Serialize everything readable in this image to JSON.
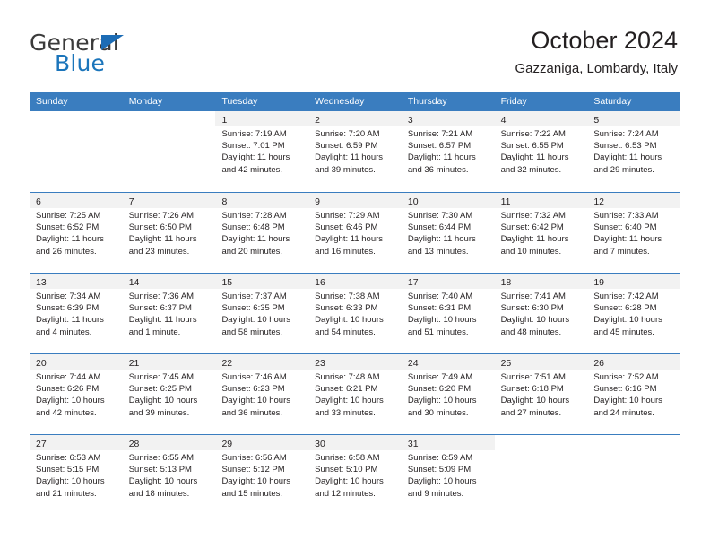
{
  "brand": {
    "name_top": "General",
    "name_bottom": "Blue",
    "triangle_color": "#1c6cb5",
    "blue_text_color": "#1b75bb"
  },
  "header": {
    "title": "October 2024",
    "subtitle": "Gazzaniga, Lombardy, Italy"
  },
  "colors": {
    "header_blue": "#3a7dbf",
    "daynum_band": "#f2f2f2",
    "text": "#231f20"
  },
  "weekdays": [
    "Sunday",
    "Monday",
    "Tuesday",
    "Wednesday",
    "Thursday",
    "Friday",
    "Saturday"
  ],
  "weeks": [
    [
      {
        "empty": true
      },
      {
        "empty": true
      },
      {
        "day": "1",
        "sunrise": "Sunrise: 7:19 AM",
        "sunset": "Sunset: 7:01 PM",
        "daylight1": "Daylight: 11 hours",
        "daylight2": "and 42 minutes."
      },
      {
        "day": "2",
        "sunrise": "Sunrise: 7:20 AM",
        "sunset": "Sunset: 6:59 PM",
        "daylight1": "Daylight: 11 hours",
        "daylight2": "and 39 minutes."
      },
      {
        "day": "3",
        "sunrise": "Sunrise: 7:21 AM",
        "sunset": "Sunset: 6:57 PM",
        "daylight1": "Daylight: 11 hours",
        "daylight2": "and 36 minutes."
      },
      {
        "day": "4",
        "sunrise": "Sunrise: 7:22 AM",
        "sunset": "Sunset: 6:55 PM",
        "daylight1": "Daylight: 11 hours",
        "daylight2": "and 32 minutes."
      },
      {
        "day": "5",
        "sunrise": "Sunrise: 7:24 AM",
        "sunset": "Sunset: 6:53 PM",
        "daylight1": "Daylight: 11 hours",
        "daylight2": "and 29 minutes."
      }
    ],
    [
      {
        "day": "6",
        "sunrise": "Sunrise: 7:25 AM",
        "sunset": "Sunset: 6:52 PM",
        "daylight1": "Daylight: 11 hours",
        "daylight2": "and 26 minutes."
      },
      {
        "day": "7",
        "sunrise": "Sunrise: 7:26 AM",
        "sunset": "Sunset: 6:50 PM",
        "daylight1": "Daylight: 11 hours",
        "daylight2": "and 23 minutes."
      },
      {
        "day": "8",
        "sunrise": "Sunrise: 7:28 AM",
        "sunset": "Sunset: 6:48 PM",
        "daylight1": "Daylight: 11 hours",
        "daylight2": "and 20 minutes."
      },
      {
        "day": "9",
        "sunrise": "Sunrise: 7:29 AM",
        "sunset": "Sunset: 6:46 PM",
        "daylight1": "Daylight: 11 hours",
        "daylight2": "and 16 minutes."
      },
      {
        "day": "10",
        "sunrise": "Sunrise: 7:30 AM",
        "sunset": "Sunset: 6:44 PM",
        "daylight1": "Daylight: 11 hours",
        "daylight2": "and 13 minutes."
      },
      {
        "day": "11",
        "sunrise": "Sunrise: 7:32 AM",
        "sunset": "Sunset: 6:42 PM",
        "daylight1": "Daylight: 11 hours",
        "daylight2": "and 10 minutes."
      },
      {
        "day": "12",
        "sunrise": "Sunrise: 7:33 AM",
        "sunset": "Sunset: 6:40 PM",
        "daylight1": "Daylight: 11 hours",
        "daylight2": "and 7 minutes."
      }
    ],
    [
      {
        "day": "13",
        "sunrise": "Sunrise: 7:34 AM",
        "sunset": "Sunset: 6:39 PM",
        "daylight1": "Daylight: 11 hours",
        "daylight2": "and 4 minutes."
      },
      {
        "day": "14",
        "sunrise": "Sunrise: 7:36 AM",
        "sunset": "Sunset: 6:37 PM",
        "daylight1": "Daylight: 11 hours",
        "daylight2": "and 1 minute."
      },
      {
        "day": "15",
        "sunrise": "Sunrise: 7:37 AM",
        "sunset": "Sunset: 6:35 PM",
        "daylight1": "Daylight: 10 hours",
        "daylight2": "and 58 minutes."
      },
      {
        "day": "16",
        "sunrise": "Sunrise: 7:38 AM",
        "sunset": "Sunset: 6:33 PM",
        "daylight1": "Daylight: 10 hours",
        "daylight2": "and 54 minutes."
      },
      {
        "day": "17",
        "sunrise": "Sunrise: 7:40 AM",
        "sunset": "Sunset: 6:31 PM",
        "daylight1": "Daylight: 10 hours",
        "daylight2": "and 51 minutes."
      },
      {
        "day": "18",
        "sunrise": "Sunrise: 7:41 AM",
        "sunset": "Sunset: 6:30 PM",
        "daylight1": "Daylight: 10 hours",
        "daylight2": "and 48 minutes."
      },
      {
        "day": "19",
        "sunrise": "Sunrise: 7:42 AM",
        "sunset": "Sunset: 6:28 PM",
        "daylight1": "Daylight: 10 hours",
        "daylight2": "and 45 minutes."
      }
    ],
    [
      {
        "day": "20",
        "sunrise": "Sunrise: 7:44 AM",
        "sunset": "Sunset: 6:26 PM",
        "daylight1": "Daylight: 10 hours",
        "daylight2": "and 42 minutes."
      },
      {
        "day": "21",
        "sunrise": "Sunrise: 7:45 AM",
        "sunset": "Sunset: 6:25 PM",
        "daylight1": "Daylight: 10 hours",
        "daylight2": "and 39 minutes."
      },
      {
        "day": "22",
        "sunrise": "Sunrise: 7:46 AM",
        "sunset": "Sunset: 6:23 PM",
        "daylight1": "Daylight: 10 hours",
        "daylight2": "and 36 minutes."
      },
      {
        "day": "23",
        "sunrise": "Sunrise: 7:48 AM",
        "sunset": "Sunset: 6:21 PM",
        "daylight1": "Daylight: 10 hours",
        "daylight2": "and 33 minutes."
      },
      {
        "day": "24",
        "sunrise": "Sunrise: 7:49 AM",
        "sunset": "Sunset: 6:20 PM",
        "daylight1": "Daylight: 10 hours",
        "daylight2": "and 30 minutes."
      },
      {
        "day": "25",
        "sunrise": "Sunrise: 7:51 AM",
        "sunset": "Sunset: 6:18 PM",
        "daylight1": "Daylight: 10 hours",
        "daylight2": "and 27 minutes."
      },
      {
        "day": "26",
        "sunrise": "Sunrise: 7:52 AM",
        "sunset": "Sunset: 6:16 PM",
        "daylight1": "Daylight: 10 hours",
        "daylight2": "and 24 minutes."
      }
    ],
    [
      {
        "day": "27",
        "sunrise": "Sunrise: 6:53 AM",
        "sunset": "Sunset: 5:15 PM",
        "daylight1": "Daylight: 10 hours",
        "daylight2": "and 21 minutes."
      },
      {
        "day": "28",
        "sunrise": "Sunrise: 6:55 AM",
        "sunset": "Sunset: 5:13 PM",
        "daylight1": "Daylight: 10 hours",
        "daylight2": "and 18 minutes."
      },
      {
        "day": "29",
        "sunrise": "Sunrise: 6:56 AM",
        "sunset": "Sunset: 5:12 PM",
        "daylight1": "Daylight: 10 hours",
        "daylight2": "and 15 minutes."
      },
      {
        "day": "30",
        "sunrise": "Sunrise: 6:58 AM",
        "sunset": "Sunset: 5:10 PM",
        "daylight1": "Daylight: 10 hours",
        "daylight2": "and 12 minutes."
      },
      {
        "day": "31",
        "sunrise": "Sunrise: 6:59 AM",
        "sunset": "Sunset: 5:09 PM",
        "daylight1": "Daylight: 10 hours",
        "daylight2": "and 9 minutes."
      },
      {
        "empty": true
      },
      {
        "empty": true
      }
    ]
  ]
}
